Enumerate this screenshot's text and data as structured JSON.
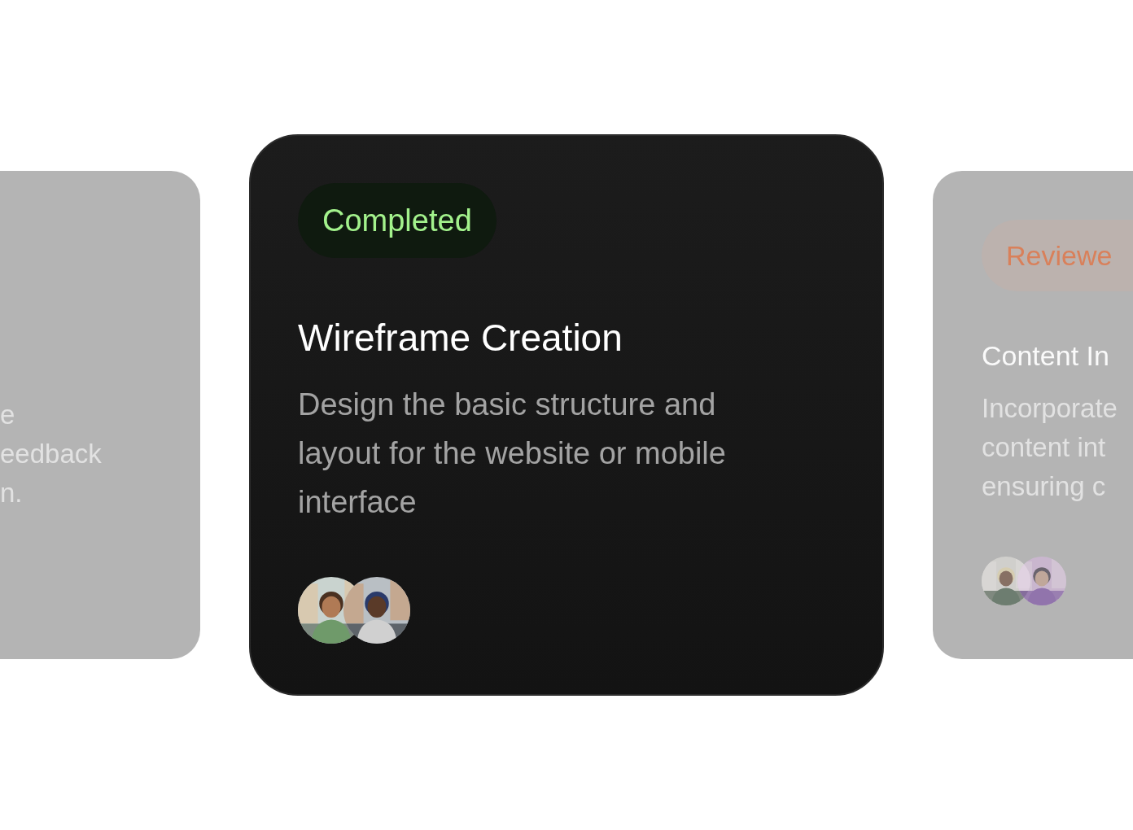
{
  "cards": [
    {
      "selected": false,
      "description_lines": [
        "e",
        "eedback",
        "n."
      ]
    },
    {
      "selected": true,
      "badge": {
        "label": "Completed",
        "color": "#a3f28c"
      },
      "title": "Wireframe Creation",
      "description_lines": [
        "Design the basic structure and",
        "layout for the website or mobile",
        "interface"
      ]
    },
    {
      "selected": false,
      "badge": {
        "label": "Reviewe",
        "color": "#d9805a"
      },
      "title": "Content In",
      "description_lines": [
        "Incorporate",
        "content int",
        "ensuring c"
      ]
    }
  ]
}
